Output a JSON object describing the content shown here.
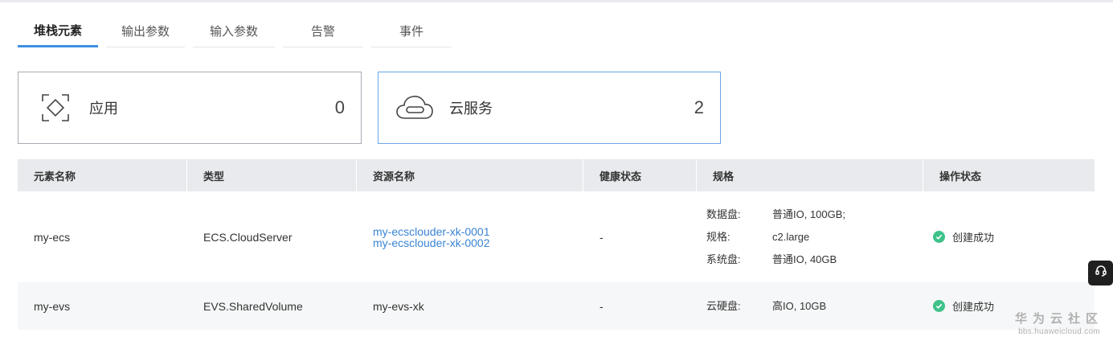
{
  "tabs": [
    {
      "label": "堆栈元素",
      "active": true
    },
    {
      "label": "输出参数",
      "active": false
    },
    {
      "label": "输入参数",
      "active": false
    },
    {
      "label": "告警",
      "active": false
    },
    {
      "label": "事件",
      "active": false
    }
  ],
  "cards": {
    "app": {
      "label": "应用",
      "count": "0",
      "icon": "app-frame-icon"
    },
    "cloud": {
      "label": "云服务",
      "count": "2",
      "icon": "cloud-icon"
    }
  },
  "table": {
    "headers": [
      "元素名称",
      "类型",
      "资源名称",
      "健康状态",
      "规格",
      "操作状态"
    ],
    "rows": [
      {
        "name": "my-ecs",
        "type": "ECS.CloudServer",
        "resources": [
          "my-ecsclouder-xk-0001",
          "my-ecsclouder-xk-0002"
        ],
        "health": "-",
        "spec": [
          {
            "k": "数据盘:",
            "v": "普通IO, 100GB;"
          },
          {
            "k": "规格:",
            "v": "c2.large"
          },
          {
            "k": "系统盘:",
            "v": "普通IO, 40GB"
          }
        ],
        "status": "创建成功"
      },
      {
        "name": "my-evs",
        "type": "EVS.SharedVolume",
        "resource": "my-evs-xk",
        "health": "-",
        "spec": [
          {
            "k": "云硬盘:",
            "v": "高IO, 10GB"
          }
        ],
        "status": "创建成功"
      }
    ]
  },
  "watermark": {
    "cn": "华为云社区",
    "url": "bbs.huaweicloud.com"
  },
  "colors": {
    "accent": "#3e8fe3",
    "link": "#3a84d6",
    "success": "#3fc28a"
  }
}
